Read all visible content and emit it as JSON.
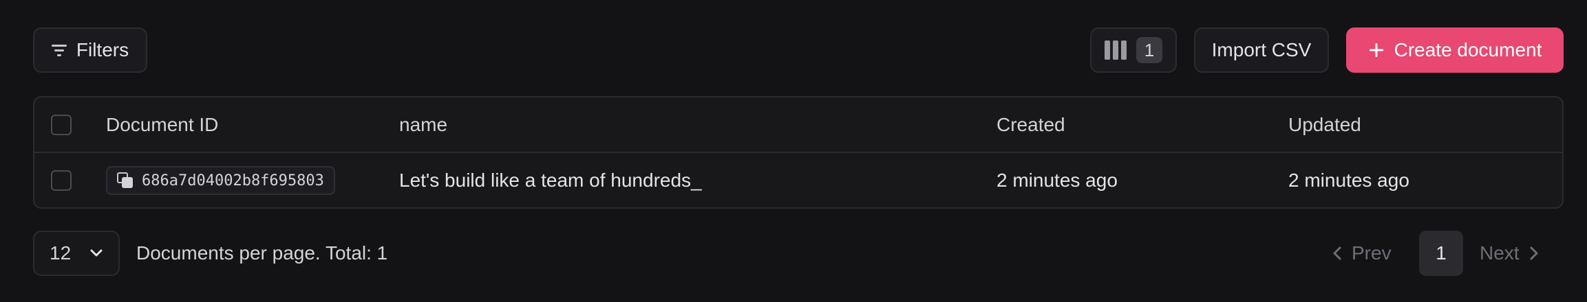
{
  "toolbar": {
    "filters_label": "Filters",
    "columns_count": "1",
    "import_label": "Import CSV",
    "create_label": "Create document",
    "accent_color": "#e84871"
  },
  "table": {
    "headers": [
      "Document ID",
      "name",
      "Created",
      "Updated"
    ],
    "rows": [
      {
        "id": "686a7d04002b8f695803",
        "name": "Let's build like a team of hundreds_",
        "created": "2 minutes ago",
        "updated": "2 minutes ago"
      }
    ]
  },
  "footer": {
    "per_page": "12",
    "total_text": "Documents per page. Total: 1",
    "prev_label": "Prev",
    "current_page": "1",
    "next_label": "Next"
  },
  "icons": [
    "filter-icon",
    "columns-icon",
    "plus-icon",
    "copy-icon",
    "chevron-down-icon",
    "chevron-left-icon",
    "chevron-right-icon"
  ]
}
